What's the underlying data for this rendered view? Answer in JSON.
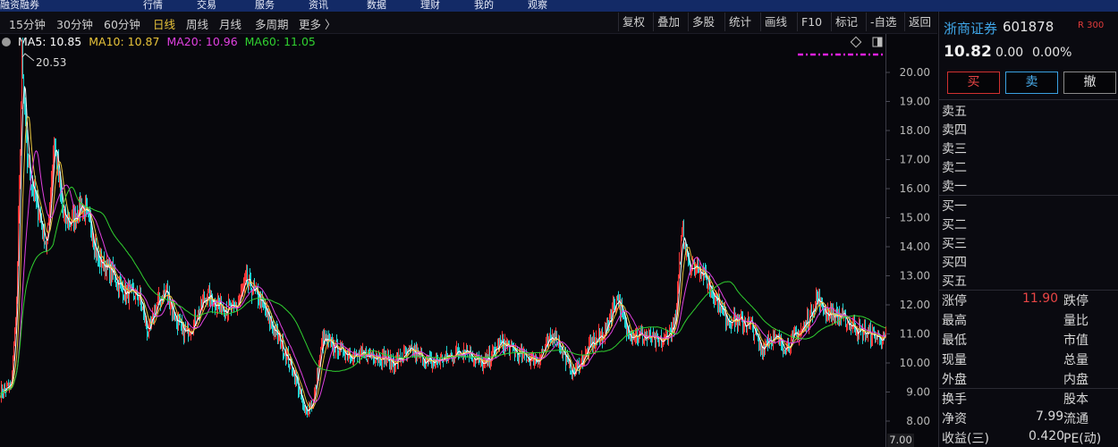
{
  "top_strip": {
    "left_text": "融资融券",
    "mid_items": [
      "行情",
      "交易",
      "服务",
      "资讯",
      "数据",
      "理财",
      "我的",
      "观察"
    ]
  },
  "periods": [
    {
      "label": "15分钟"
    },
    {
      "label": "30分钟"
    },
    {
      "label": "60分钟"
    },
    {
      "label": "日线",
      "active": true
    },
    {
      "label": "周线"
    },
    {
      "label": "月线"
    },
    {
      "label": "多周期"
    },
    {
      "label": "更多 〉"
    }
  ],
  "tools": [
    "复权",
    "叠加",
    "多股",
    "统计",
    "画线",
    "F10",
    "标记",
    "-自选",
    "返回"
  ],
  "ma": {
    "ma5": "MA5: 10.85",
    "ma10": "MA10: 10.87",
    "ma20": "MA20: 10.96",
    "ma60": "MA60: 11.05",
    "colors": {
      "ma5": "#ffffff",
      "ma10": "#e8c33a",
      "ma20": "#e040e0",
      "ma60": "#30d030"
    }
  },
  "chart_data": {
    "type": "candlestick",
    "y_ticks": [
      "20.00",
      "19.00",
      "18.00",
      "17.00",
      "16.00",
      "15.00",
      "14.00",
      "13.00",
      "12.00",
      "11.00",
      "10.00",
      "9.00",
      "8.00"
    ],
    "y_bottom_label": "7.00",
    "ylim": [
      7.0,
      20.53
    ],
    "max_label": "20.53",
    "key_closes": [
      [
        0,
        9.0
      ],
      [
        12,
        9.2
      ],
      [
        18,
        12.0
      ],
      [
        24,
        20.3
      ],
      [
        30,
        17.0
      ],
      [
        40,
        15.5
      ],
      [
        52,
        14.0
      ],
      [
        60,
        17.8
      ],
      [
        70,
        15.0
      ],
      [
        80,
        14.8
      ],
      [
        90,
        15.5
      ],
      [
        100,
        14.8
      ],
      [
        110,
        13.5
      ],
      [
        120,
        13.3
      ],
      [
        140,
        12.4
      ],
      [
        155,
        12.3
      ],
      [
        165,
        11.0
      ],
      [
        175,
        12.0
      ],
      [
        185,
        12.5
      ],
      [
        195,
        11.6
      ],
      [
        205,
        11.0
      ],
      [
        215,
        11.3
      ],
      [
        230,
        12.3
      ],
      [
        245,
        12.0
      ],
      [
        262,
        11.8
      ],
      [
        275,
        12.8
      ],
      [
        290,
        12.2
      ],
      [
        300,
        11.5
      ],
      [
        315,
        10.6
      ],
      [
        330,
        9.5
      ],
      [
        340,
        8.3
      ],
      [
        350,
        8.7
      ],
      [
        360,
        10.8
      ],
      [
        370,
        10.6
      ],
      [
        385,
        10.4
      ],
      [
        400,
        10.2
      ],
      [
        420,
        10.3
      ],
      [
        440,
        10.0
      ],
      [
        460,
        10.4
      ],
      [
        480,
        10.0
      ],
      [
        500,
        10.2
      ],
      [
        520,
        10.5
      ],
      [
        540,
        9.9
      ],
      [
        560,
        10.7
      ],
      [
        580,
        10.3
      ],
      [
        600,
        10.1
      ],
      [
        620,
        11.0
      ],
      [
        640,
        9.6
      ],
      [
        660,
        10.6
      ],
      [
        675,
        11.0
      ],
      [
        690,
        12.3
      ],
      [
        700,
        11.1
      ],
      [
        720,
        10.9
      ],
      [
        740,
        10.7
      ],
      [
        755,
        11.4
      ],
      [
        762,
        14.6
      ],
      [
        772,
        13.2
      ],
      [
        780,
        13.4
      ],
      [
        790,
        12.8
      ],
      [
        800,
        12.3
      ],
      [
        810,
        11.6
      ],
      [
        820,
        11.5
      ],
      [
        840,
        11.3
      ],
      [
        850,
        10.5
      ],
      [
        860,
        10.9
      ],
      [
        880,
        10.6
      ],
      [
        900,
        11.3
      ],
      [
        912,
        12.2
      ],
      [
        925,
        11.7
      ],
      [
        940,
        11.6
      ],
      [
        960,
        11.1
      ],
      [
        990,
        10.82
      ]
    ]
  },
  "panel": {
    "name": "浙商证券",
    "code": "601878",
    "badge": "R 300",
    "price": "10.82",
    "change": "0.00",
    "pct": "0.00%",
    "buy_label": "买",
    "sell_label": "卖",
    "cancel_label": "撤",
    "sell_rows": [
      "卖五",
      "卖四",
      "卖三",
      "卖二",
      "卖一"
    ],
    "buy_rows": [
      "买一",
      "买二",
      "买三",
      "买四",
      "买五"
    ],
    "stats": {
      "limit_up_label": "涨停",
      "limit_up_value": "11.90",
      "limit_down_label": "跌停",
      "high_label": "最高",
      "volratio_label": "量比",
      "low_label": "最低",
      "mktval_label": "市值",
      "current_label": "现量",
      "totalvol_label": "总量",
      "outer_label": "外盘",
      "inner_label": "内盘",
      "turnover_label": "换手",
      "capital_label": "股本",
      "netasset_label": "净资",
      "netasset_value": "7.99",
      "float_label": "流通",
      "earnings_label": "收益(三)",
      "earnings_value": "0.420",
      "pe_label": "PE(动)"
    }
  }
}
